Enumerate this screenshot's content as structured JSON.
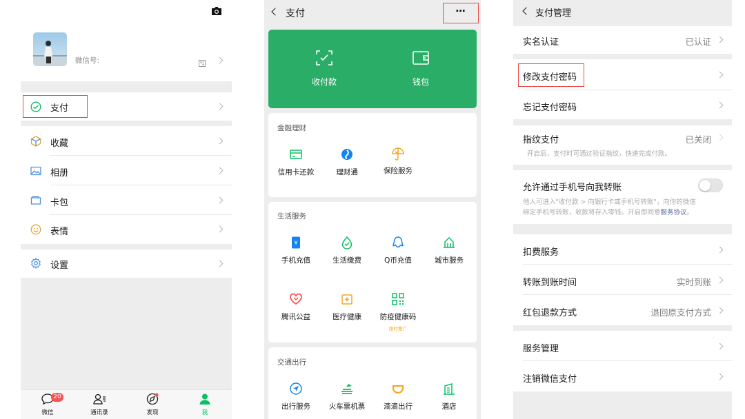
{
  "me": {
    "wechat_id_label": "微信号:",
    "menu": [
      {
        "icon": "pay-icon",
        "label": "支付"
      },
      {
        "icon": "favorites-icon",
        "label": "收藏"
      },
      {
        "icon": "album-icon",
        "label": "相册"
      },
      {
        "icon": "cards-icon",
        "label": "卡包"
      },
      {
        "icon": "sticker-icon",
        "label": "表情"
      },
      {
        "icon": "settings-icon",
        "label": "设置"
      }
    ],
    "tabbar": [
      {
        "icon": "chat-icon",
        "label": "微信",
        "badge": "20"
      },
      {
        "icon": "contacts-icon",
        "label": "通讯录"
      },
      {
        "icon": "discover-icon",
        "label": "发现"
      },
      {
        "icon": "me-icon",
        "label": "我"
      }
    ],
    "colors": {
      "accent": "#07c160",
      "badge": "#fa5151",
      "highlight": "#e94b4b"
    }
  },
  "pay": {
    "title": "支付",
    "more": "···",
    "banner": [
      {
        "icon": "receive-pay-icon",
        "label": "收付款"
      },
      {
        "icon": "wallet-icon",
        "label": "钱包"
      }
    ],
    "sections": [
      {
        "title": "金融理财",
        "items": [
          {
            "icon": "credit-card-icon",
            "label": "信用卡还款"
          },
          {
            "icon": "wealth-icon",
            "label": "理财通"
          },
          {
            "icon": "insurance-icon",
            "label": "保险服务"
          }
        ]
      },
      {
        "title": "生活服务",
        "items": [
          {
            "icon": "mobile-topup-icon",
            "label": "手机充值"
          },
          {
            "icon": "utilities-icon",
            "label": "生活缴费"
          },
          {
            "icon": "qcoin-icon",
            "label": "Q币充值"
          },
          {
            "icon": "city-icon",
            "label": "城市服务"
          },
          {
            "icon": "charity-icon",
            "label": "腾讯公益"
          },
          {
            "icon": "medical-icon",
            "label": "医疗健康"
          },
          {
            "icon": "health-code-icon",
            "label": "防疫健康码",
            "tag": "限时推广"
          }
        ]
      },
      {
        "title": "交通出行",
        "items": [
          {
            "icon": "travel-icon",
            "label": "出行服务"
          },
          {
            "icon": "train-icon",
            "label": "火车票机票"
          },
          {
            "icon": "didi-icon",
            "label": "滴滴出行"
          },
          {
            "icon": "hotel-icon",
            "label": "酒店"
          }
        ]
      }
    ],
    "colors": {
      "banner": "#2aae67"
    }
  },
  "manage": {
    "title": "支付管理",
    "rows": {
      "realname": {
        "label": "实名认证",
        "value": "已认证"
      },
      "change_pwd": {
        "label": "修改支付密码"
      },
      "forgot_pwd": {
        "label": "忘记支付密码"
      },
      "fingerprint": {
        "label": "指纹支付",
        "value": "已关闭",
        "desc": "开启后，支付时可通过验证指纹，快速完成付款。"
      },
      "phone_transfer": {
        "label": "允许通过手机号向我转账",
        "toggle": false,
        "desc1": "他人可进入\"收付款 > 向银行卡或手机号转账\"，向你的微信",
        "desc2": "绑定手机号转账，收款将存入零钱。开启即同意",
        "link": "服务协议",
        "desc_end": "。"
      },
      "deduction": {
        "label": "扣费服务"
      },
      "arrival_time": {
        "label": "转账到账时间",
        "value": "实时到账"
      },
      "red_packet": {
        "label": "红包退款方式",
        "value": "退回原支付方式"
      },
      "service_mgmt": {
        "label": "服务管理"
      },
      "cancel_pay": {
        "label": "注销微信支付"
      }
    },
    "colors": {
      "link": "#576b95"
    }
  }
}
